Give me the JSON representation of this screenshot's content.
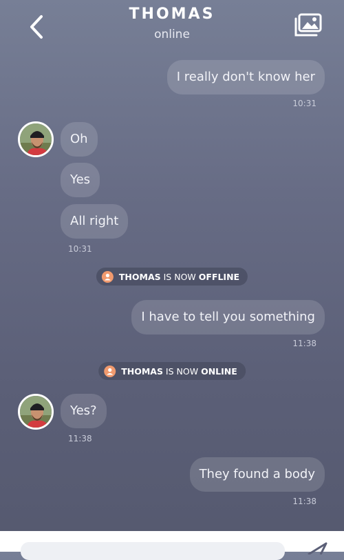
{
  "header": {
    "back_icon": "chevron-left-icon",
    "title": "THOMAS",
    "subtitle": "online",
    "gallery_icon": "photo-gallery-icon"
  },
  "messages": [
    {
      "text": "I really don't know her",
      "direction": "outgoing"
    },
    {
      "time": "10:31"
    },
    {
      "text": "Oh",
      "direction": "incoming"
    },
    {
      "text": "Yes",
      "direction": "incoming"
    },
    {
      "text": "All right",
      "direction": "incoming"
    },
    {
      "time": "10:31"
    },
    {
      "text": "I have to tell you something",
      "direction": "outgoing"
    },
    {
      "time": "11:38"
    },
    {
      "text": "Yes?",
      "direction": "incoming"
    },
    {
      "time": "11:38"
    },
    {
      "text": "They found a body",
      "direction": "outgoing"
    },
    {
      "time": "11:38"
    }
  ],
  "status_notices": [
    {
      "name": "THOMAS",
      "middle": "IS NOW",
      "state": "OFFLINE"
    },
    {
      "name": "THOMAS",
      "middle": "IS NOW",
      "state": "ONLINE"
    }
  ],
  "composer": {
    "placeholder": "",
    "send_icon": "send-arrow-icon"
  },
  "colors": {
    "accent": "#f19a6e",
    "background_top": "#777f96",
    "background_bottom": "#55596f"
  }
}
